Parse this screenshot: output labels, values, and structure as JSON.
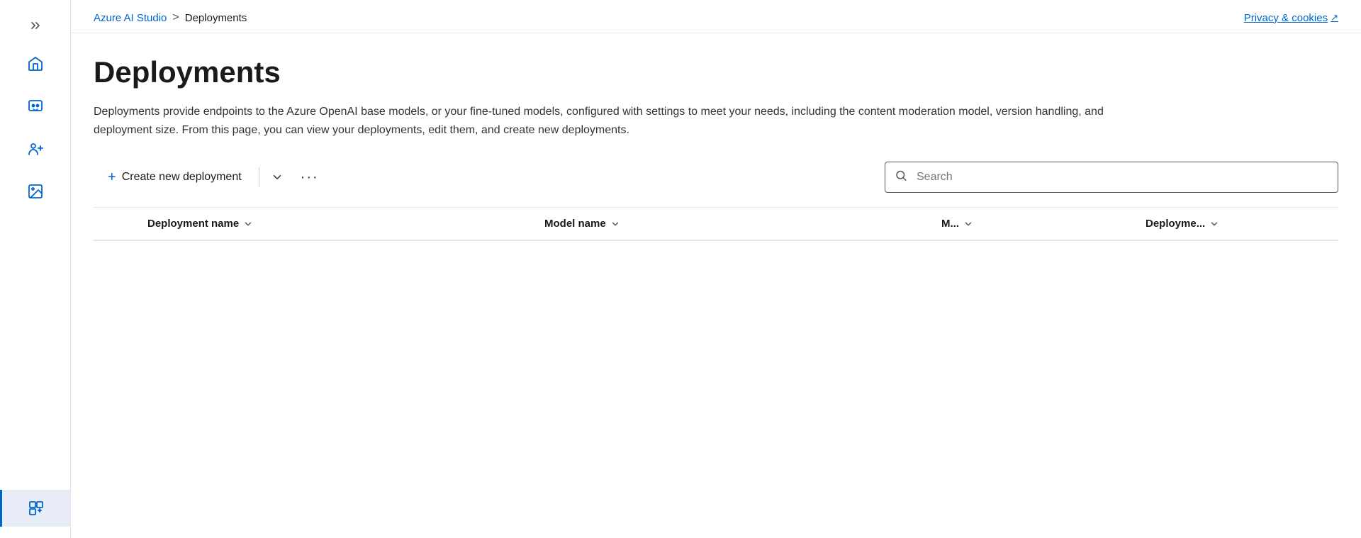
{
  "breadcrumb": {
    "link_text": "Azure AI Studio",
    "separator": ">",
    "current": "Deployments"
  },
  "privacy": {
    "label": "Privacy & cookies",
    "external_icon": "↗"
  },
  "page": {
    "title": "Deployments",
    "description": "Deployments provide endpoints to the Azure OpenAI base models, or your fine-tuned models, configured with settings to meet your needs, including the content moderation model, version handling, and deployment size. From this page, you can view your deployments, edit them, and create new deployments."
  },
  "toolbar": {
    "create_label": "Create new deployment",
    "search_placeholder": "Search"
  },
  "table": {
    "columns": [
      {
        "id": "deployment-name",
        "label": "Deployment name"
      },
      {
        "id": "model-name",
        "label": "Model name"
      },
      {
        "id": "m",
        "label": "M..."
      },
      {
        "id": "deployme",
        "label": "Deployme..."
      }
    ]
  },
  "sidebar": {
    "items": [
      {
        "id": "home",
        "icon": "home"
      },
      {
        "id": "chat",
        "icon": "chat"
      },
      {
        "id": "users",
        "icon": "users"
      },
      {
        "id": "images",
        "icon": "images"
      }
    ]
  }
}
